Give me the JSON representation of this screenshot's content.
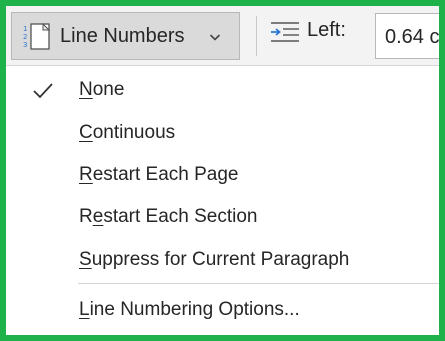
{
  "ribbon": {
    "line_numbers": {
      "label": "Line Numbers",
      "icon": "line-numbers-icon",
      "dropdown_icon": "chevron-down-icon"
    },
    "indent_left": {
      "icon": "indent-left-icon",
      "label": "Left:",
      "value": "0.64 c"
    }
  },
  "menu": {
    "items": [
      {
        "pre": "",
        "key": "N",
        "post": "one",
        "checked": true
      },
      {
        "pre": "",
        "key": "C",
        "post": "ontinuous",
        "checked": false
      },
      {
        "pre": "",
        "key": "R",
        "post": "estart Each Page",
        "checked": false
      },
      {
        "pre": "R",
        "key": "e",
        "post": "start Each Section",
        "checked": false
      },
      {
        "pre": "",
        "key": "S",
        "post": "uppress for Current Paragraph",
        "checked": false
      },
      {
        "pre": "",
        "key": "L",
        "post": "ine Numbering Options...",
        "checked": false
      }
    ]
  },
  "colors": {
    "frame_border": "#1fb14a",
    "ribbon_bg": "#f3f3f3",
    "button_active_bg": "#dadada",
    "text": "#262626",
    "indent_arrow": "#2b78d4"
  }
}
